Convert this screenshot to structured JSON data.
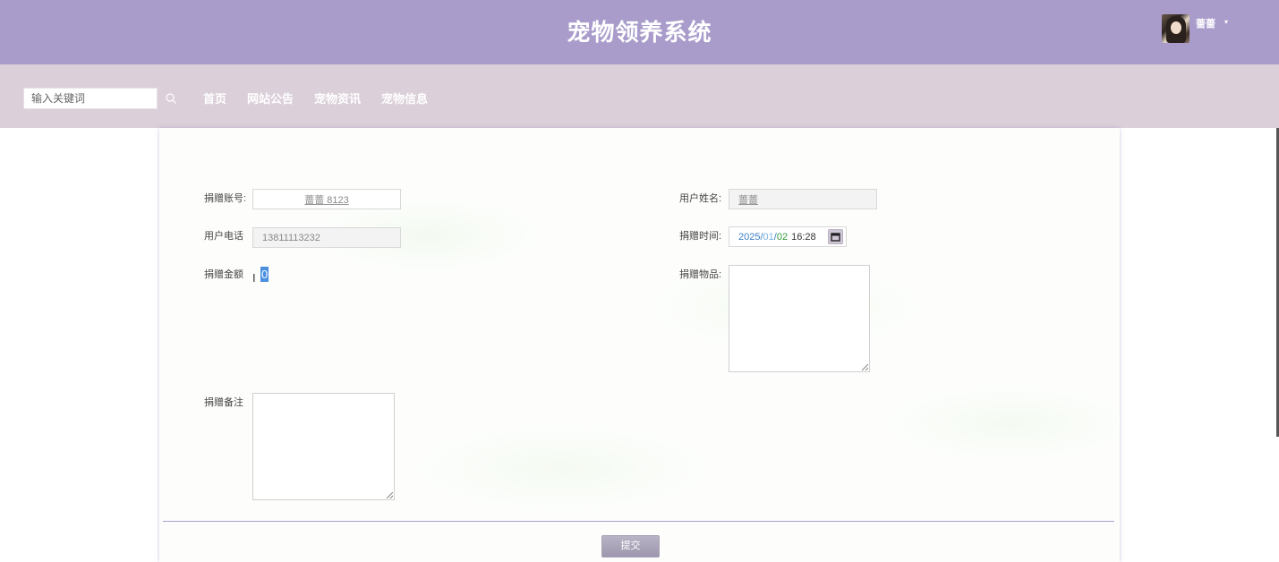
{
  "header": {
    "site_title": "宠物领养系统",
    "user_name": "蔷蔷",
    "caret": "▾",
    "background_color": "#a99ccb"
  },
  "nav": {
    "search_placeholder": "输入关键词",
    "links": [
      "首页",
      "网站公告",
      "宠物资讯",
      "宠物信息"
    ],
    "background_color": "#dbcfd9"
  },
  "form": {
    "account_label": "捐赠账号:",
    "account_value": "蔷蔷 8123",
    "user_name_label": "用户姓名:",
    "user_name_value": "蔷蔷",
    "phone_label": "用户电话",
    "phone_value": "13811113232",
    "donate_time_label": "捐赠时间:",
    "donate_time": {
      "year": "2025",
      "sep1": "/",
      "month": "01",
      "sep2": "/",
      "day": "02",
      "time": "16:28"
    },
    "amount_label": "捐赠金额",
    "amount_value": "0",
    "items_label": "捐赠物品:",
    "remark_label": "捐赠备注",
    "submit_label": "提交"
  }
}
